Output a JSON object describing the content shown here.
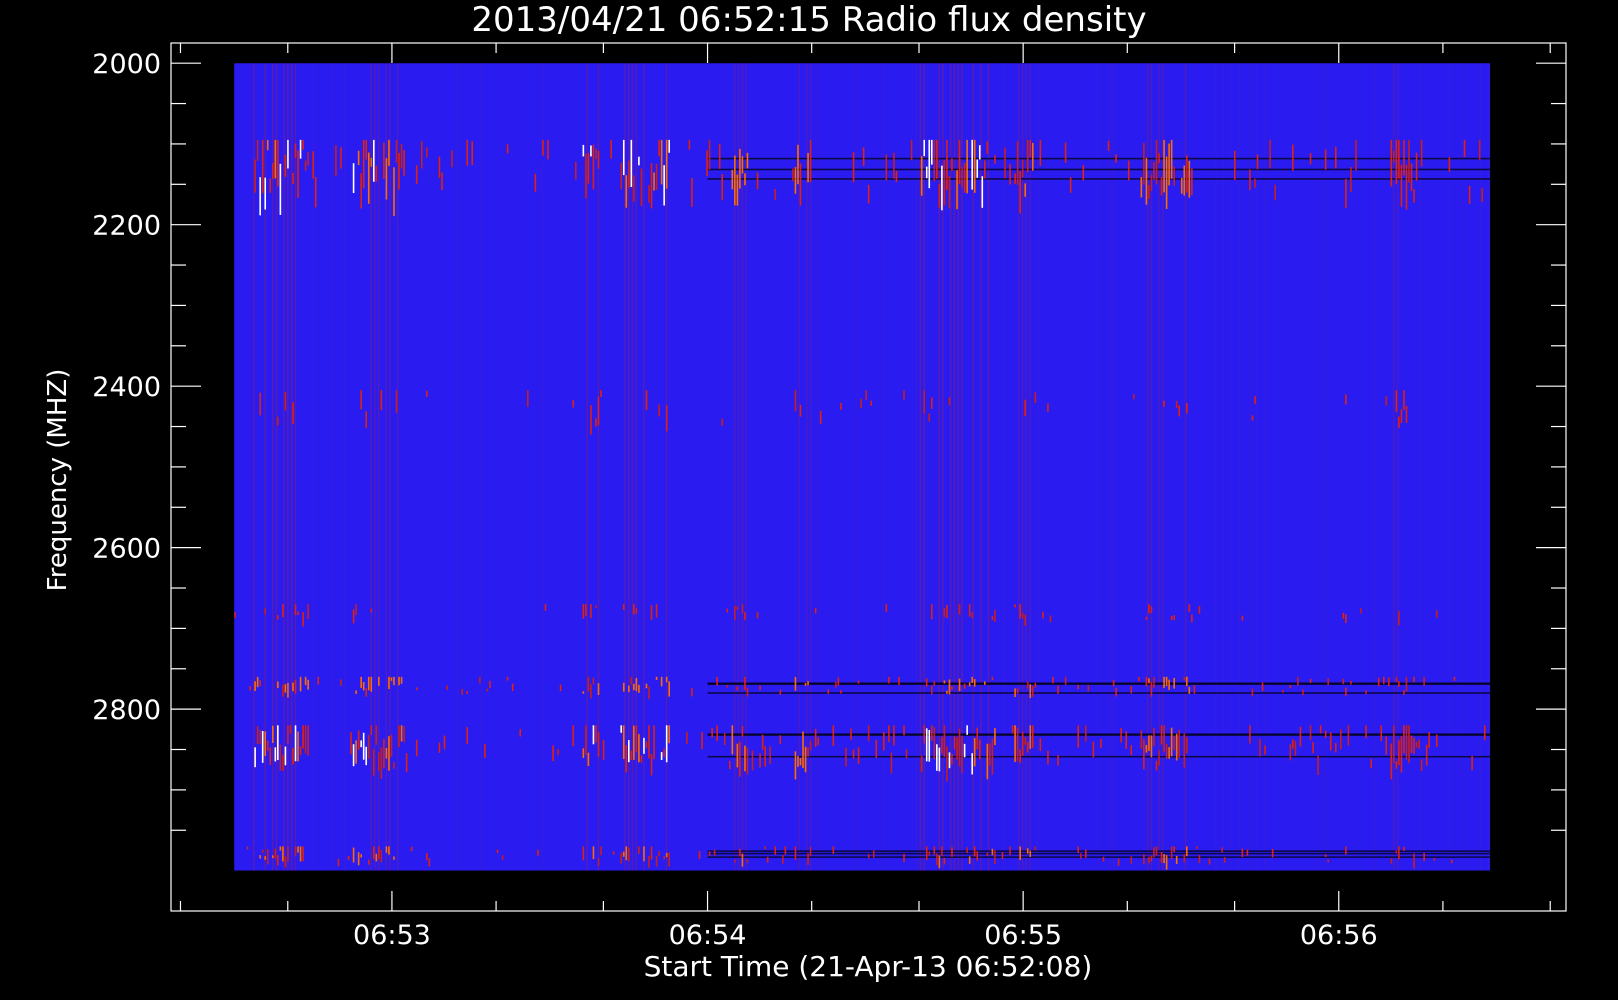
{
  "chart_data": {
    "type": "heatmap",
    "title": "2013/04/21 06:52:15 Radio flux density",
    "xlabel": "Start Time (21-Apr-13 06:52:08)",
    "ylabel": "Frequency (MHZ)",
    "x_unit": "minutes after 06:52:00",
    "xlim": [
      0.3,
      4.72
    ],
    "ylim": [
      3050,
      1975
    ],
    "data_x_range": [
      0.5,
      4.48
    ],
    "data_y_range": [
      2000,
      3000
    ],
    "x_major_ticks": [
      1,
      2,
      3,
      4
    ],
    "x_tick_labels": [
      "06:53",
      "06:54",
      "06:55",
      "06:56"
    ],
    "x_minor_ticks": [
      0.33,
      0.67,
      1.33,
      1.67,
      2.33,
      2.67,
      3.33,
      3.67,
      4.33,
      4.67
    ],
    "y_major_ticks": [
      2000,
      2200,
      2400,
      2600,
      2800
    ],
    "y_tick_labels": [
      "2000",
      "2200",
      "2400",
      "2600",
      "2800"
    ],
    "y_minor_ticks": [
      2050,
      2100,
      2150,
      2250,
      2300,
      2350,
      2450,
      2500,
      2550,
      2650,
      2700,
      2750,
      2850,
      2900,
      2950
    ],
    "background_color": "#2a1cf0",
    "colorscale": [
      "#000000",
      "#1a10c0",
      "#2a1cf0",
      "#c81e1e",
      "#ff2a00",
      "#ffff00",
      "#ffffff"
    ],
    "bright_bands_mhz": [
      {
        "freq_min": 2095,
        "freq_max": 2165,
        "intensity": "high"
      },
      {
        "freq_min": 2405,
        "freq_max": 2445,
        "intensity": "low"
      },
      {
        "freq_min": 2670,
        "freq_max": 2690,
        "intensity": "low"
      },
      {
        "freq_min": 2760,
        "freq_max": 2780,
        "intensity": "medium"
      },
      {
        "freq_min": 2820,
        "freq_max": 2870,
        "intensity": "high"
      },
      {
        "freq_min": 2970,
        "freq_max": 2990,
        "intensity": "medium"
      }
    ],
    "burst_columns": [
      {
        "x": 0.65,
        "width": 0.09,
        "strength": 0.85
      },
      {
        "x": 0.92,
        "width": 0.05,
        "strength": 0.7
      },
      {
        "x": 1.0,
        "width": 0.03,
        "strength": 0.6
      },
      {
        "x": 1.63,
        "width": 0.03,
        "strength": 0.8
      },
      {
        "x": 1.8,
        "width": 0.08,
        "strength": 0.75
      },
      {
        "x": 2.1,
        "width": 0.03,
        "strength": 0.5
      },
      {
        "x": 2.3,
        "width": 0.03,
        "strength": 0.45
      },
      {
        "x": 2.79,
        "width": 0.12,
        "strength": 0.95
      },
      {
        "x": 3.0,
        "width": 0.03,
        "strength": 0.5
      },
      {
        "x": 3.45,
        "width": 0.08,
        "strength": 0.55
      },
      {
        "x": 4.2,
        "width": 0.04,
        "strength": 0.35
      }
    ],
    "grid": false
  }
}
